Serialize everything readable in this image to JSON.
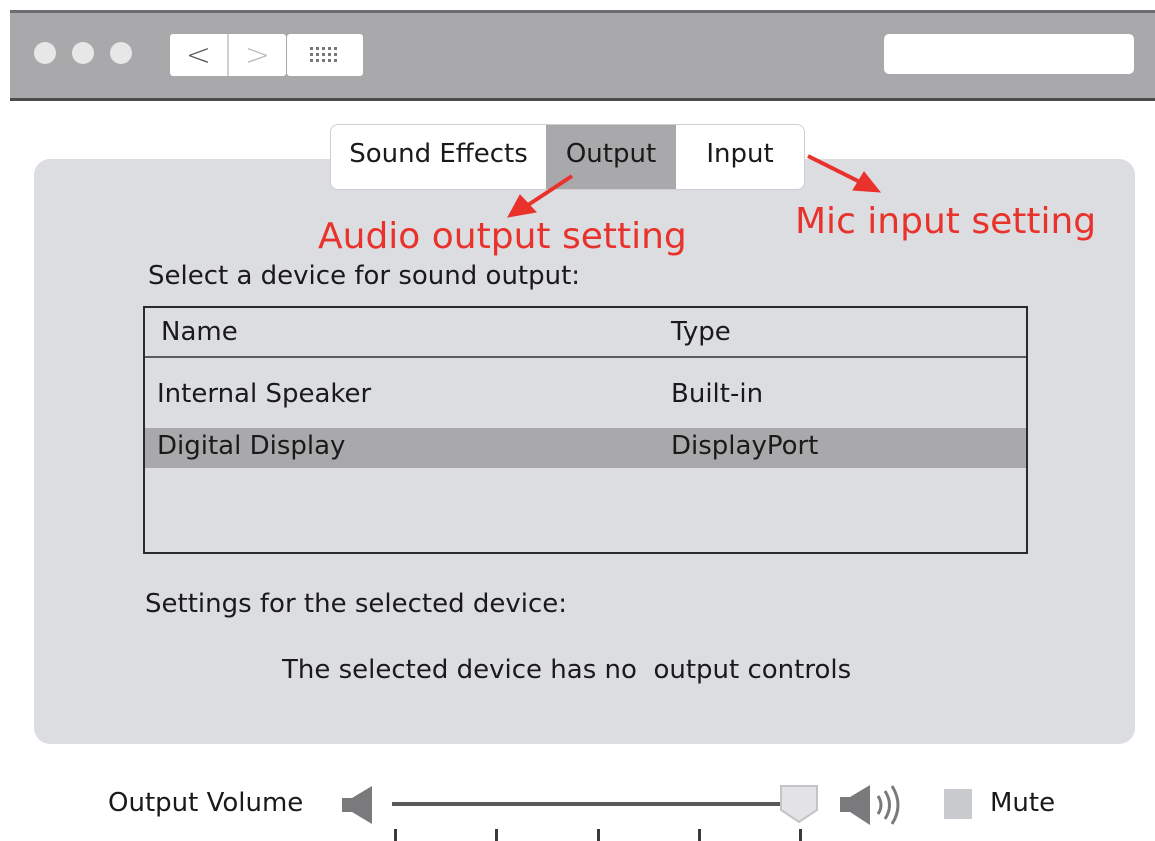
{
  "toolbar": {
    "back_glyph": "<",
    "forward_glyph": ">",
    "grid_icon": "grid-icon",
    "search_placeholder": ""
  },
  "tabs": [
    {
      "label": "Sound Effects",
      "selected": false
    },
    {
      "label": "Output",
      "selected": true
    },
    {
      "label": "Input",
      "selected": false
    }
  ],
  "annotations": {
    "output_note": "Audio output setting",
    "input_note": "Mic input setting",
    "color": "#e8322b"
  },
  "device_prompt": "Select a device for sound output:",
  "device_table": {
    "headers": [
      "Name",
      "Type"
    ],
    "rows": [
      {
        "name": "Internal Speaker",
        "type": "Built-in",
        "selected": false
      },
      {
        "name": "Digital Display",
        "type": "DisplayPort",
        "selected": true
      }
    ]
  },
  "settings": {
    "heading": "Settings for the selected device:",
    "message": "The selected device has no  output controls"
  },
  "volume": {
    "label": "Output Volume",
    "level": 1.0,
    "ticks": 5,
    "min_icon": "speaker-low-icon",
    "max_icon": "speaker-high-icon",
    "mute_label": "Mute",
    "muted": false
  },
  "colors": {
    "panel_bg": "#dcdde1",
    "selected_bg": "#a9a9ab",
    "titlebar_bg": "#a9a9ab"
  }
}
